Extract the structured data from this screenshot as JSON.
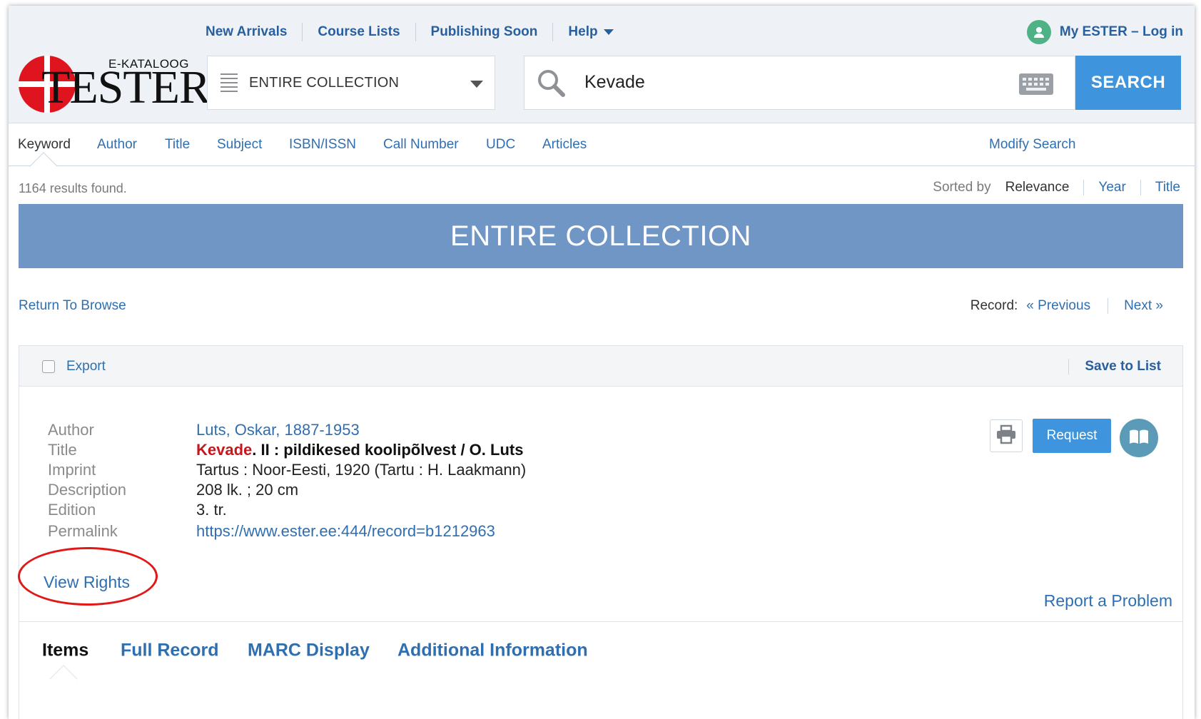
{
  "header": {
    "top_links": [
      "New Arrivals",
      "Course Lists",
      "Publishing Soon"
    ],
    "help_label": "Help",
    "account_label": "My ESTER – Log in",
    "logo": {
      "small_text": "E-KATALOOG",
      "word": "TESTER"
    },
    "scope_value": "ENTIRE COLLECTION",
    "search_value": "Kevade",
    "search_button": "SEARCH"
  },
  "search_tabs": {
    "items": [
      "Keyword",
      "Author",
      "Title",
      "Subject",
      "ISBN/ISSN",
      "Call Number",
      "UDC",
      "Articles"
    ],
    "active": "Keyword",
    "modify": "Modify Search"
  },
  "results": {
    "count_text": "1164 results found.",
    "sorted_label": "Sorted by",
    "sort_options": [
      "Relevance",
      "Year",
      "Title"
    ]
  },
  "banner": "ENTIRE COLLECTION",
  "nav": {
    "return": "Return To Browse",
    "record_label": "Record:",
    "previous": "« Previous",
    "next": "Next »"
  },
  "panel": {
    "export_label": "Export",
    "save_to_list": "Save to List",
    "fields": {
      "author_label": "Author",
      "author_value": "Luts, Oskar, 1887-1953",
      "title_label": "Title",
      "title_highlight": "Kevade",
      "title_rest": ". II : pildikesed koolipõlvest / O. Luts",
      "imprint_label": "Imprint",
      "imprint_value": "Tartus : Noor-Eesti, 1920 (Tartu : H. Laakmann)",
      "description_label": "Description",
      "description_value": "208 lk. ; 20 cm",
      "edition_label": "Edition",
      "edition_value": "3. tr.",
      "permalink_label": "Permalink",
      "permalink_value": "https://www.ester.ee:444/record=b1212963"
    },
    "request_button": "Request",
    "view_rights": "View Rights",
    "report_problem": "Report a Problem",
    "detail_tabs": [
      "Items",
      "Full Record",
      "MARC Display",
      "Additional Information"
    ],
    "active_detail_tab": "Items"
  },
  "colors": {
    "primary_blue": "#3e95dd",
    "banner_blue": "#7096c5",
    "link_blue": "#2f6fb0",
    "highlight_red": "#c8161d",
    "annotation_ring": "#e01818"
  },
  "icons": [
    "user-icon",
    "list-icon",
    "dropdown-caret-icon",
    "search-icon",
    "keyboard-icon",
    "print-icon",
    "book-icon"
  ]
}
